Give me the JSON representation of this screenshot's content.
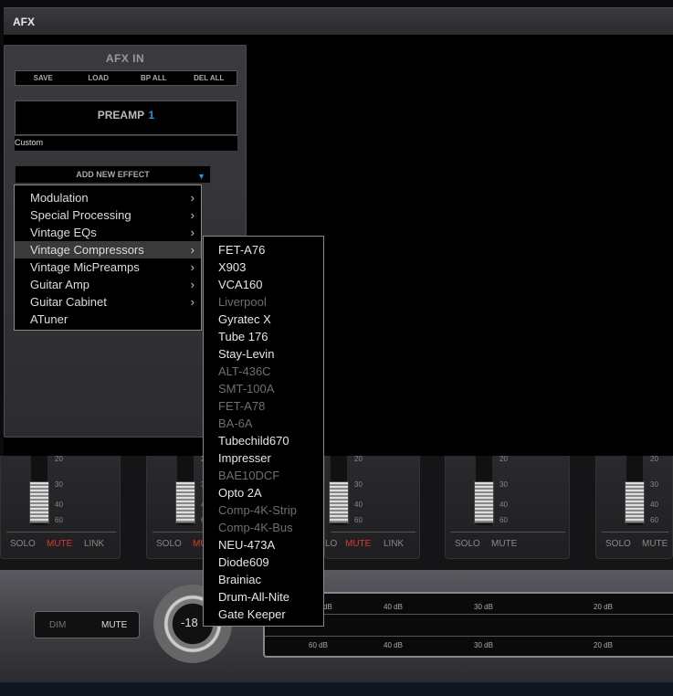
{
  "window": {
    "title": "AFX"
  },
  "afx": {
    "title": "AFX IN",
    "buttons": [
      "SAVE",
      "LOAD",
      "BP ALL",
      "DEL ALL"
    ],
    "preamp_label": "PREAMP",
    "preamp_number": "1",
    "preset_name": "Custom",
    "add_effect_label": "ADD NEW EFFECT"
  },
  "effect_menu": {
    "items": [
      {
        "label": "Modulation",
        "submenu": true
      },
      {
        "label": "Special Processing",
        "submenu": true
      },
      {
        "label": "Vintage EQs",
        "submenu": true
      },
      {
        "label": "Vintage Compressors",
        "submenu": true,
        "active": true
      },
      {
        "label": "Vintage MicPreamps",
        "submenu": true
      },
      {
        "label": "Guitar Amp",
        "submenu": true
      },
      {
        "label": "Guitar Cabinet",
        "submenu": true
      },
      {
        "label": "ATuner",
        "submenu": false
      }
    ]
  },
  "compressor_menu": {
    "items": [
      {
        "label": "FET-A76",
        "enabled": true
      },
      {
        "label": "X903",
        "enabled": true
      },
      {
        "label": "VCA160",
        "enabled": true
      },
      {
        "label": "Liverpool",
        "enabled": false
      },
      {
        "label": "Gyratec X",
        "enabled": true
      },
      {
        "label": "Tube 176",
        "enabled": true
      },
      {
        "label": "Stay-Levin",
        "enabled": true
      },
      {
        "label": "ALT-436C",
        "enabled": false
      },
      {
        "label": "SMT-100A",
        "enabled": false
      },
      {
        "label": "FET-A78",
        "enabled": false
      },
      {
        "label": "BA-6A",
        "enabled": false
      },
      {
        "label": "Tubechild670",
        "enabled": true
      },
      {
        "label": "Impresser",
        "enabled": true
      },
      {
        "label": "BAE10DCF",
        "enabled": false
      },
      {
        "label": "Opto 2A",
        "enabled": true
      },
      {
        "label": "Comp-4K-Strip",
        "enabled": false
      },
      {
        "label": "Comp-4K-Bus",
        "enabled": false
      },
      {
        "label": "NEU-473A",
        "enabled": true
      },
      {
        "label": "Diode609",
        "enabled": true
      },
      {
        "label": "Brainiac",
        "enabled": true
      },
      {
        "label": "Drum-All-Nite",
        "enabled": true
      },
      {
        "label": "Gate Keeper",
        "enabled": true
      }
    ]
  },
  "channel_strips": {
    "scale": [
      "20",
      "30",
      "40",
      "60"
    ],
    "strips": [
      {
        "solo": "SOLO",
        "mute": "MUTE",
        "link": "LINK",
        "mute_active": true
      },
      {
        "solo": "SOLO",
        "mute": "MU",
        "link": "",
        "mute_active": true
      },
      {
        "solo": "LO",
        "mute": "MUTE",
        "link": "LINK",
        "mute_active": true
      },
      {
        "solo": "SOLO",
        "mute": "MUTE",
        "link": "",
        "mute_active": false
      },
      {
        "solo": "SOLO",
        "mute": "MUTE",
        "link": "",
        "mute_active": false
      }
    ]
  },
  "monitor": {
    "dim_label": "DIM",
    "mute_label": "MUTE",
    "knob_value": "-18",
    "meter_top": [
      "dB",
      "40 dB",
      "30 dB",
      "20 dB"
    ],
    "meter_bottom": [
      "60 dB",
      "40 dB",
      "30 dB",
      "20 dB"
    ]
  },
  "colors": {
    "accent_blue": "#2e8fd6",
    "mute_red": "#d63a2e"
  }
}
